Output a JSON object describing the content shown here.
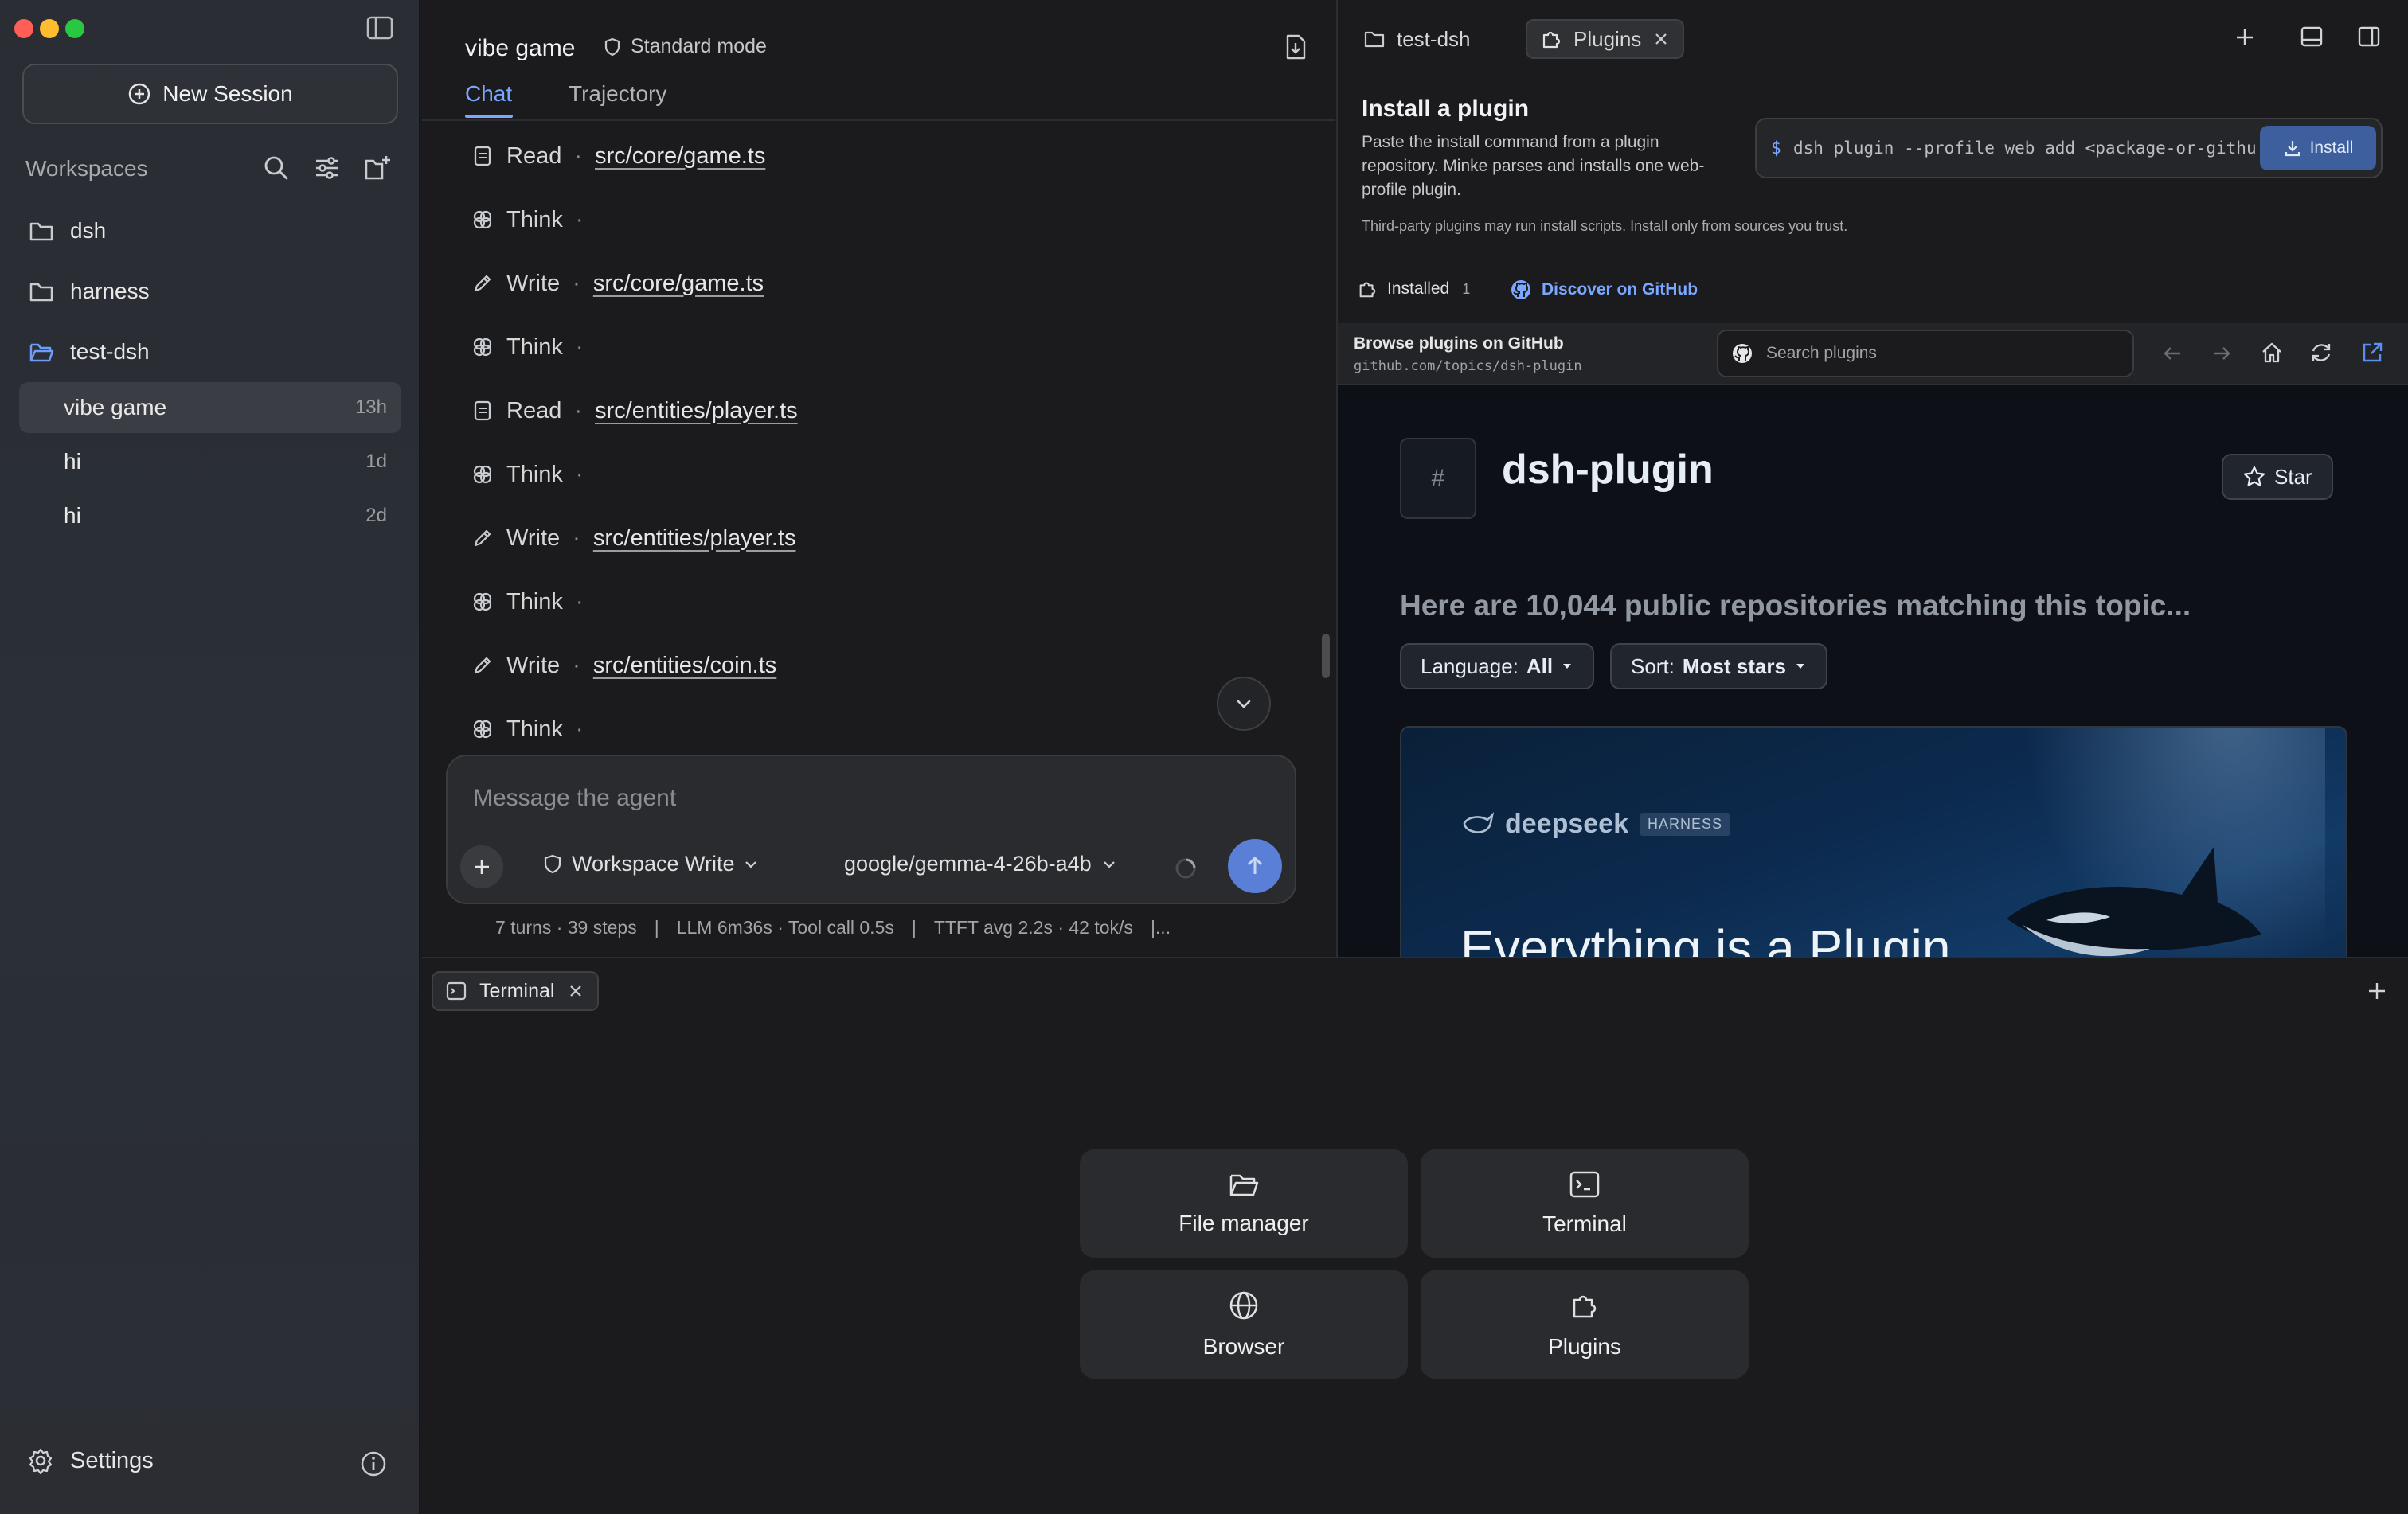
{
  "sidebar": {
    "new_session": "New Session",
    "workspaces_label": "Workspaces",
    "workspaces": [
      {
        "name": "dsh"
      },
      {
        "name": "harness"
      },
      {
        "name": "test-dsh"
      }
    ],
    "sessions": [
      {
        "name": "vibe game",
        "age": "13h"
      },
      {
        "name": "hi",
        "age": "1d"
      },
      {
        "name": "hi",
        "age": "2d"
      }
    ],
    "settings": "Settings"
  },
  "chat": {
    "title": "vibe game",
    "mode": "Standard mode",
    "tabs": [
      "Chat",
      "Trajectory"
    ],
    "steps": [
      {
        "action": "Read",
        "sep": "·",
        "path": "src/core/game.ts"
      },
      {
        "action": "Think",
        "sep": "·",
        "path": ""
      },
      {
        "action": "Write",
        "sep": "·",
        "path": "src/core/game.ts"
      },
      {
        "action": "Think",
        "sep": "·",
        "path": ""
      },
      {
        "action": "Read",
        "sep": "·",
        "path": "src/entities/player.ts"
      },
      {
        "action": "Think",
        "sep": "·",
        "path": ""
      },
      {
        "action": "Write",
        "sep": "·",
        "path": "src/entities/player.ts"
      },
      {
        "action": "Think",
        "sep": "·",
        "path": ""
      },
      {
        "action": "Write",
        "sep": "·",
        "path": "src/entities/coin.ts"
      },
      {
        "action": "Think",
        "sep": "·",
        "path": ""
      }
    ],
    "composer": {
      "placeholder": "Message the agent",
      "permission": "Workspace Write",
      "model": "google/gemma-4-26b-a4b"
    },
    "stats": {
      "turns": "7 turns · 39 steps",
      "llm": "LLM 6m36s · Tool call 0.5s",
      "ttft": "TTFT avg 2.2s · 42 tok/s",
      "more": "|...",
      "sep": "|"
    }
  },
  "right": {
    "tabs": [
      {
        "label": "test-dsh"
      },
      {
        "label": "Plugins"
      }
    ],
    "install": {
      "title": "Install a plugin",
      "description": "Paste the install command from a plugin repository. Minke parses and installs one web-profile plugin.",
      "command_prefix": "$",
      "command": "dsh plugin --profile web add <package-or-github…",
      "button": "Install",
      "warning": "Third-party plugins may run install scripts. Install only from sources you trust."
    },
    "installed_label": "Installed",
    "installed_count": "1",
    "discover": "Discover on GitHub",
    "browser": {
      "title": "Browse plugins on GitHub",
      "url": "github.com/topics/dsh-plugin",
      "search_placeholder": "Search plugins"
    },
    "github": {
      "hash": "#",
      "topic": "dsh-plugin",
      "star": "Star",
      "heading": "Here are 10,044 public repositories matching this topic...",
      "language_label": "Language:",
      "language_value": "All",
      "sort_label": "Sort:",
      "sort_value": "Most stars",
      "banner_brand": "deepseek",
      "banner_badge": "HARNESS",
      "banner_headline": "Everything is a Plugin"
    }
  },
  "terminal": {
    "tab": "Terminal",
    "cards": [
      {
        "label": "File manager"
      },
      {
        "label": "Terminal"
      },
      {
        "label": "Browser"
      },
      {
        "label": "Plugins"
      }
    ]
  },
  "colors": {
    "accent": "#7aa7ff",
    "send_button": "#5a7fd6",
    "install_button": "#3d5f9e"
  }
}
